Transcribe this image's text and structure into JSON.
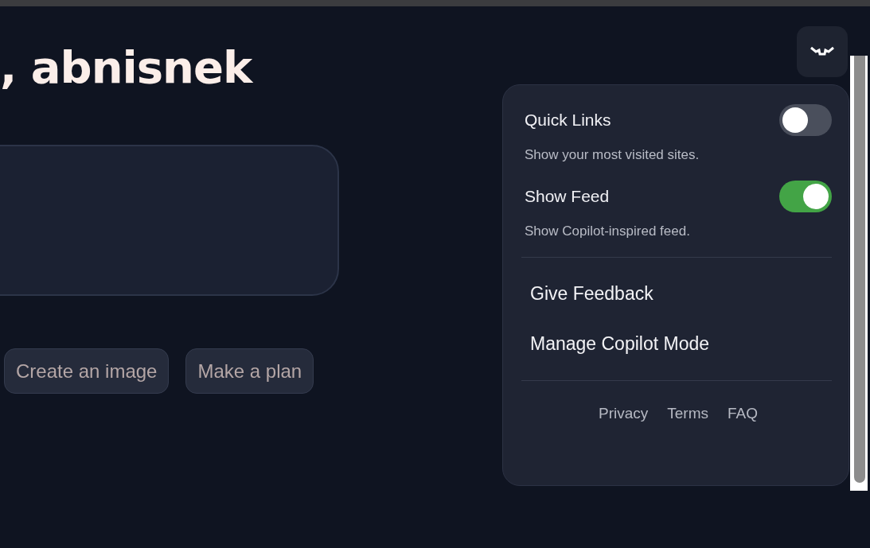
{
  "greeting": ", abnisnek",
  "suggestions": [
    {
      "label": "Create an image"
    },
    {
      "label": "Make a plan"
    }
  ],
  "settings_panel": {
    "toggles": [
      {
        "label": "Quick Links",
        "description": "Show your most visited sites.",
        "on": false
      },
      {
        "label": "Show Feed",
        "description": "Show Copilot-inspired feed.",
        "on": true
      }
    ],
    "actions": [
      "Give Feedback",
      "Manage Copilot Mode"
    ],
    "footer_links": [
      "Privacy",
      "Terms",
      "FAQ"
    ]
  }
}
